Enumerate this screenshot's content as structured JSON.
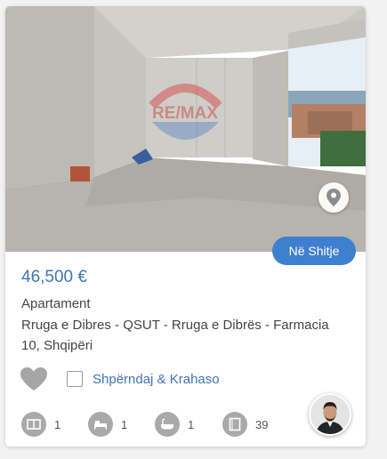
{
  "listing": {
    "watermark": "RE/MAX",
    "status": "Në Shitje",
    "price": "46,500 €",
    "property_type": "Apartament",
    "address": "Rruga e Dibres - QSUT - Rruga e Dibrës - Farmacia 10, Shqipëri",
    "share_compare_label": "Shpërndaj & Krahaso",
    "features": [
      {
        "icon": "rooms-icon",
        "value": "1"
      },
      {
        "icon": "bedroom-icon",
        "value": "1"
      },
      {
        "icon": "bathroom-icon",
        "value": "1"
      },
      {
        "icon": "area-icon",
        "value": "39"
      }
    ]
  },
  "colors": {
    "accent": "#3f74b8",
    "badge": "#3f7fcf",
    "icon_gray": "#a9a9a9"
  }
}
